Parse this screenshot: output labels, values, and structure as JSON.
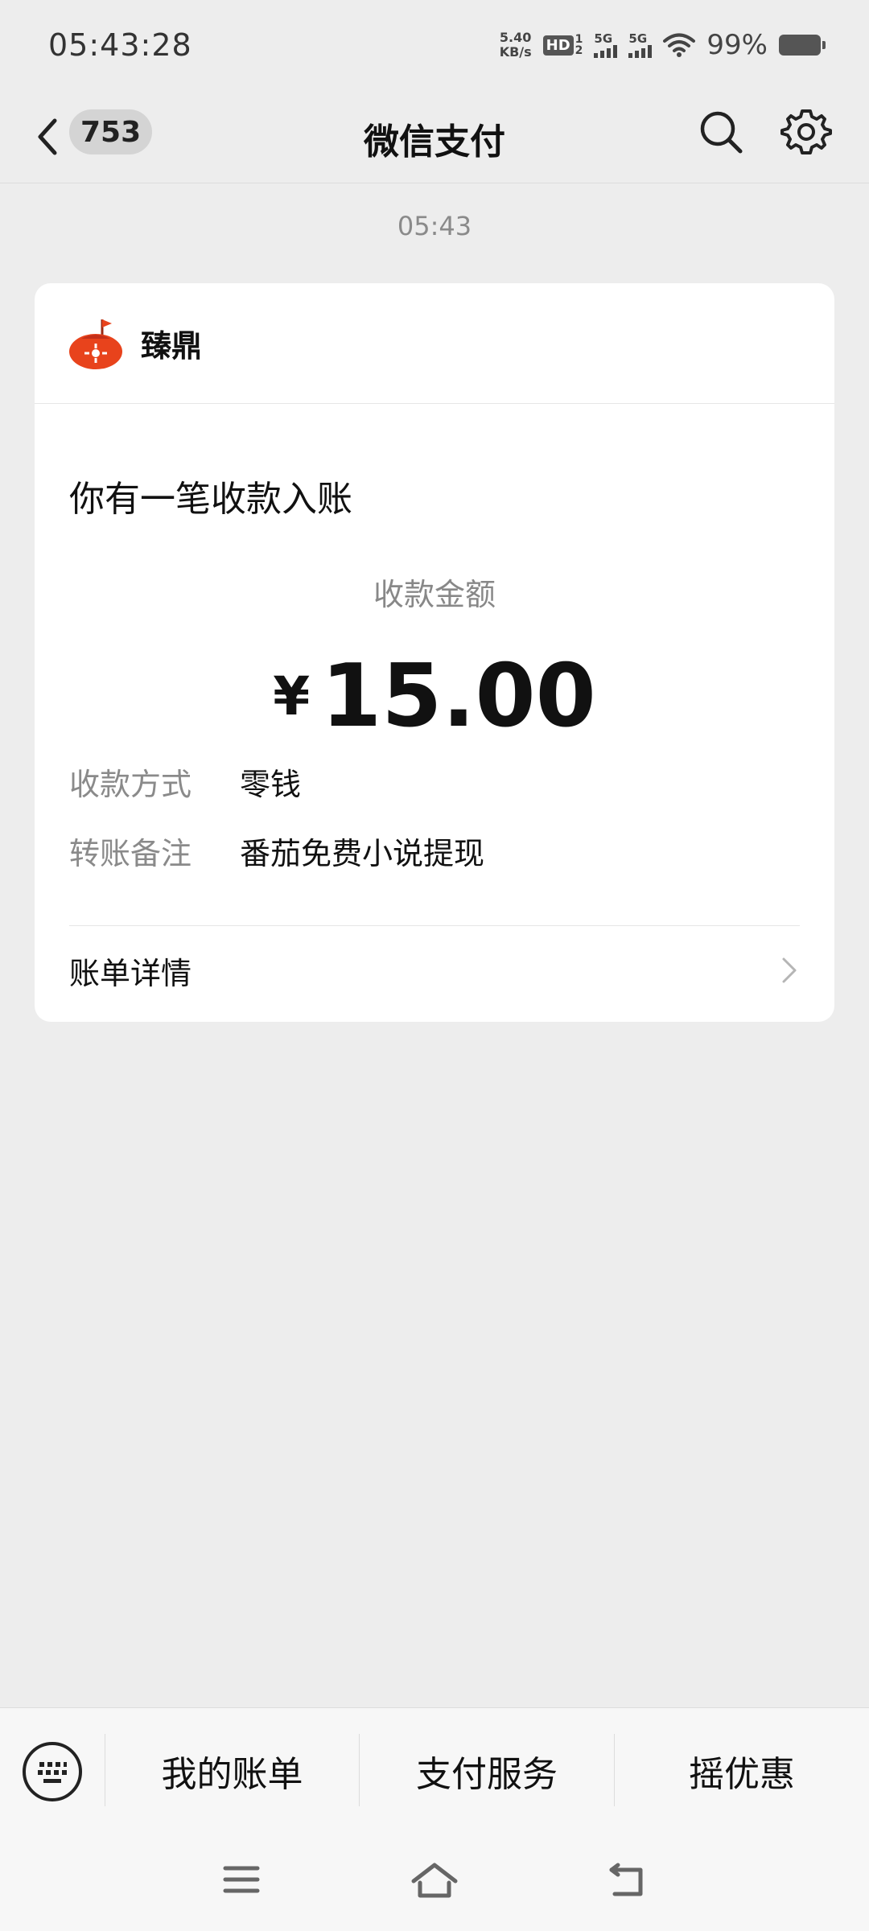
{
  "status_bar": {
    "time": "05:43:28",
    "net_speed_value": "5.40",
    "net_speed_unit": "KB/s",
    "hd_label": "HD",
    "sim_labels": [
      "1",
      "2"
    ],
    "signal_label_1": "5G",
    "signal_label_2": "5G",
    "battery_pct": "99%"
  },
  "nav": {
    "unread_count": "753",
    "title": "微信支付"
  },
  "message_time": "05:43",
  "card": {
    "brand_name": "臻鼎",
    "heading": "你有一笔收款入账",
    "amount_label": "收款金额",
    "currency_symbol": "¥",
    "amount": "15.00",
    "rows": [
      {
        "label": "收款方式",
        "value": "零钱"
      },
      {
        "label": "转账备注",
        "value": "番茄免费小说提现"
      }
    ],
    "bill_details": "账单详情"
  },
  "bottom_menu": {
    "items": [
      "我的账单",
      "支付服务",
      "摇优惠"
    ]
  },
  "colors": {
    "background": "#ededed",
    "brand_orange": "#e8431c"
  }
}
